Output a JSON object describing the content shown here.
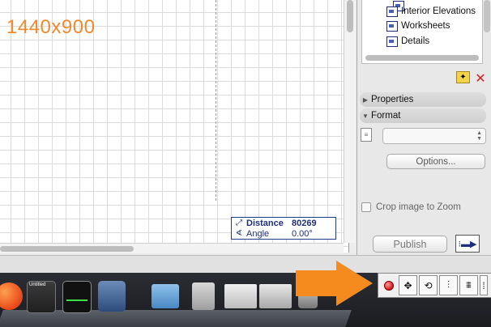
{
  "canvas": {
    "resolution_label": "1440x900"
  },
  "coordinates": {
    "distance_label": "Distance",
    "distance_value": "80269",
    "angle_label": "Angle",
    "angle_value": "0.00°"
  },
  "palette": {
    "tree_items": [
      {
        "label": "Interior Elevations"
      },
      {
        "label": "Worksheets"
      },
      {
        "label": "Details"
      }
    ],
    "properties_label": "Properties",
    "format_label": "Format",
    "format_select_value": "",
    "options_button": "Options...",
    "crop_checkbox_label": "Crop image to Zoom",
    "crop_checked": false,
    "publish_button": "Publish"
  },
  "dock": {
    "untitled_label": "Untitled"
  },
  "toolbar": {
    "buttons": [
      "move-icon",
      "rotate-icon",
      "mirror-icon",
      "elevate-icon",
      "more-icon"
    ]
  }
}
